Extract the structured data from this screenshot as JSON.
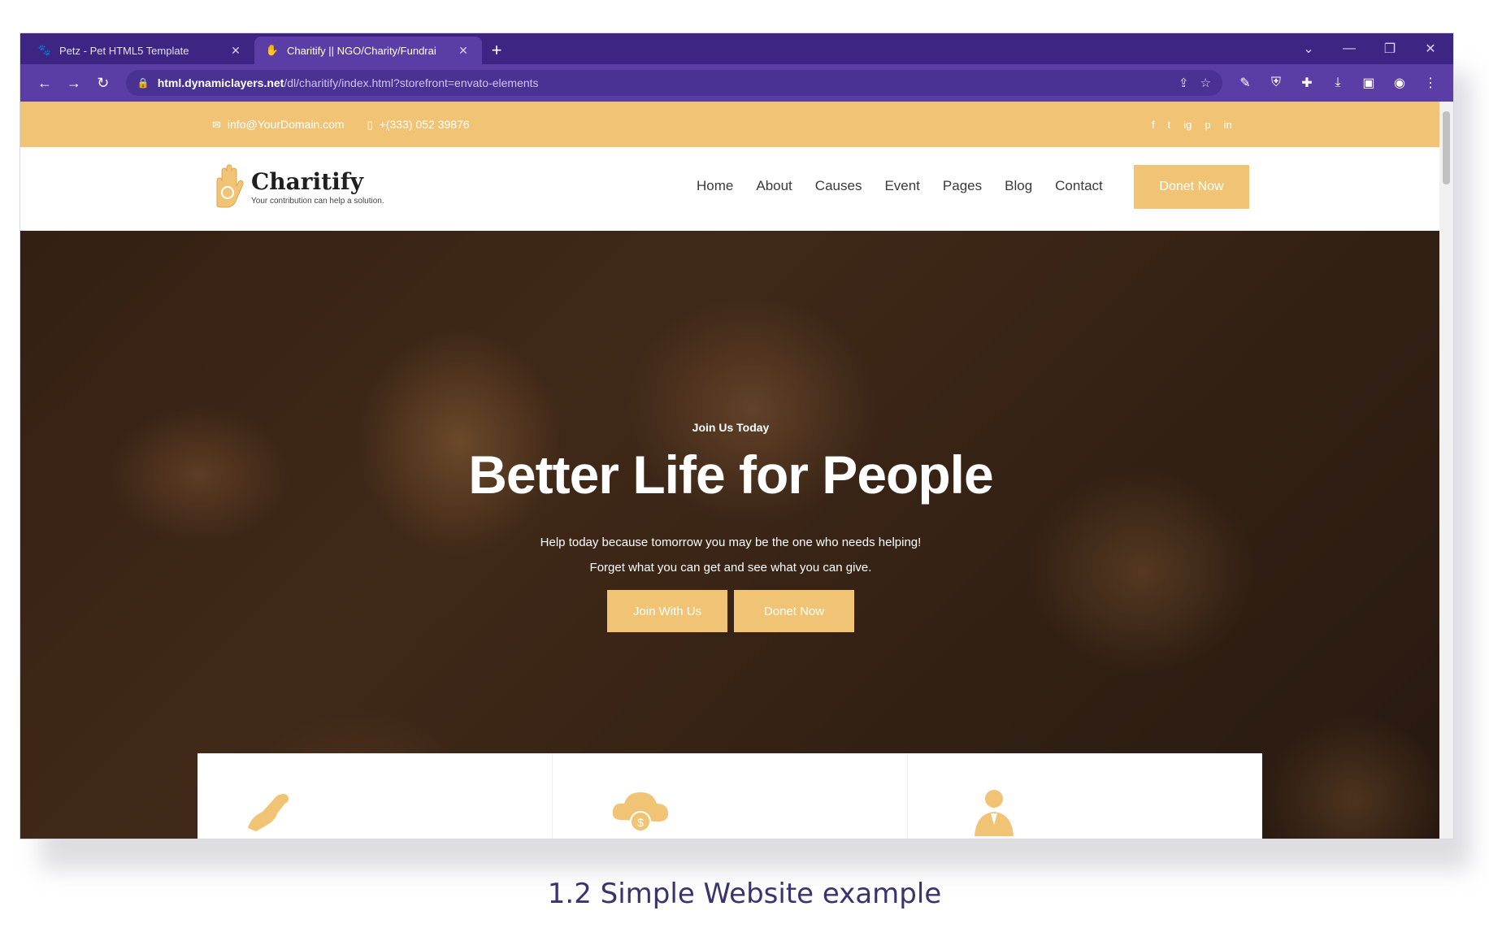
{
  "browser": {
    "tabs": [
      {
        "title": "Petz - Pet HTML5 Template",
        "favicon": "paw-icon",
        "active": false
      },
      {
        "title": "Charitify || NGO/Charity/Fundrai",
        "favicon": "hand-icon",
        "active": true
      }
    ],
    "new_tab": "+",
    "url_host": "html.dynamiclayers.net",
    "url_path": "/dl/charitify/index.html?storefront=envato-elements"
  },
  "site": {
    "topbar": {
      "email": "info@YourDomain.com",
      "phone": "+(333) 052 39876",
      "social": [
        "f",
        "t",
        "ig",
        "p",
        "in"
      ]
    },
    "logo": {
      "name": "Charitify",
      "tagline": "Your contribution can help a solution."
    },
    "nav": [
      "Home",
      "About",
      "Causes",
      "Event",
      "Pages",
      "Blog",
      "Contact"
    ],
    "donate_button": "Donet Now",
    "hero": {
      "eyebrow": "Join Us Today",
      "title": "Better Life for People",
      "sub_line1": "Help today because tomorrow you may be the one who needs helping!",
      "sub_line2": "Forget what you can get and see what you can give.",
      "btn_join": "Join With Us",
      "btn_donate": "Donet Now"
    },
    "features": [
      {
        "icon": "donate-hand-icon"
      },
      {
        "icon": "money-cloud-icon"
      },
      {
        "icon": "volunteer-person-icon"
      }
    ]
  },
  "caption": "1.2 Simple Website example",
  "colors": {
    "tab_strip": "#3d2683",
    "toolbar": "#5a3ea6",
    "accent": "#f0c474"
  }
}
